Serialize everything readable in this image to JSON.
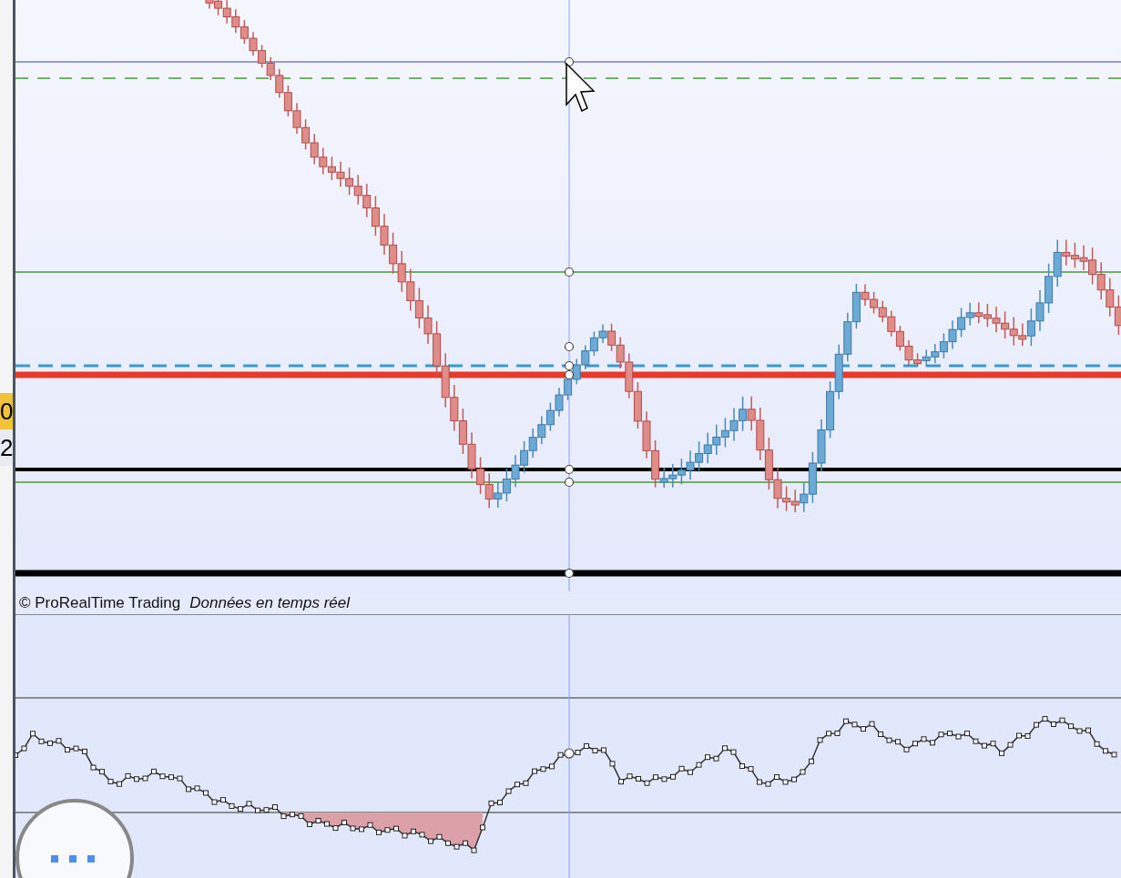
{
  "price_axis_labels": [
    {
      "text": "0",
      "kind": "highlight"
    },
    {
      "text": "2",
      "kind": "plain"
    }
  ],
  "footer": {
    "copyright": "© ProRealTime Trading",
    "data_status": "Données en temps réel"
  }
}
